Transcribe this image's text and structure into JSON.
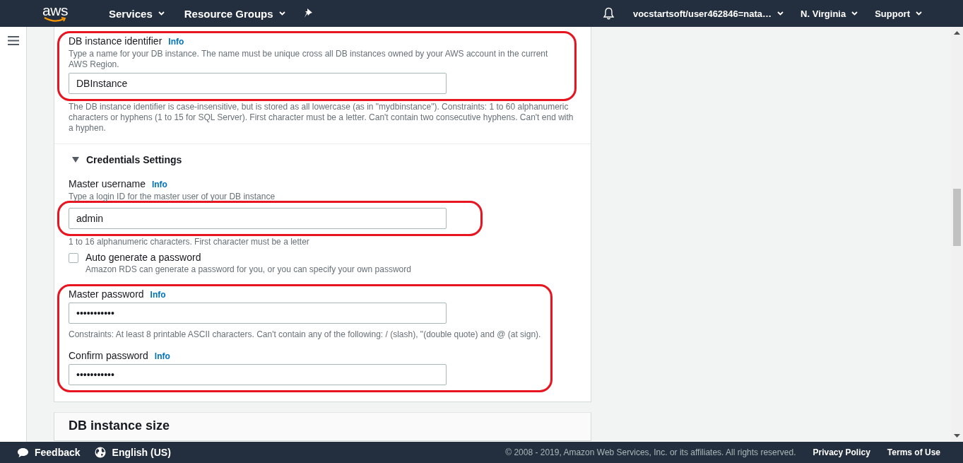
{
  "header": {
    "logo_text": "aws",
    "nav": [
      {
        "label": "Services",
        "dropdown": true
      },
      {
        "label": "Resource Groups",
        "dropdown": true
      }
    ],
    "account": "vocstartsoft/user462846=nata…",
    "region": "N. Virginia",
    "support": "Support"
  },
  "form_blocks": [
    {
      "highlighted": true,
      "items": [
        {
          "kind": "label",
          "text": "DB instance identifier",
          "info": "Info"
        },
        {
          "kind": "description",
          "text": "Type a name for your DB instance. The name must be unique cross all DB instances owned by your AWS account in the current AWS Region."
        },
        {
          "kind": "input",
          "value": "DBInstance"
        }
      ]
    },
    {
      "highlighted": false,
      "items": [
        {
          "kind": "hint",
          "text": "The DB instance identifier is case-insensitive, but is stored as all lowercase (as in \"mydbinstance\"). Constraints: 1 to 60 alphanumeric characters or hyphens (1 to 15 for SQL Server). First character must be a letter. Can't contain two consecutive hyphens. Can't end with a hyphen."
        },
        {
          "kind": "divider"
        },
        {
          "kind": "section",
          "text": "Credentials Settings",
          "expanded": true
        },
        {
          "kind": "label",
          "text": "Master username",
          "info": "Info"
        },
        {
          "kind": "description",
          "text": "Type a login ID for the master user of your DB instance"
        }
      ]
    },
    {
      "highlighted": true,
      "items": [
        {
          "kind": "input",
          "value": "admin"
        }
      ]
    },
    {
      "highlighted": false,
      "items": [
        {
          "kind": "hint",
          "text": "1 to 16 alphanumeric characters. First character must be a letter"
        },
        {
          "kind": "checkbox",
          "text": "Auto generate a password",
          "checked": false,
          "description": "Amazon RDS can generate a password for you, or you can specify your own password"
        }
      ]
    },
    {
      "highlighted": true,
      "items": [
        {
          "kind": "label",
          "text": "Master password",
          "info": "Info"
        },
        {
          "kind": "input",
          "value": "•••••••••••"
        },
        {
          "kind": "hint",
          "text": "Constraints: At least 8 printable ASCII characters. Can't contain any of the following: / (slash), \"(double quote) and @ (at sign)."
        },
        {
          "kind": "label",
          "text": "Confirm password",
          "info": "Info"
        },
        {
          "kind": "input",
          "value": "•••••••••••"
        }
      ]
    }
  ],
  "next_section": {
    "title": "DB instance size"
  },
  "footer": {
    "feedback": "Feedback",
    "language": "English (US)",
    "copyright": "© 2008 - 2019, Amazon Web Services, Inc. or its affiliates. All rights reserved.",
    "links": [
      "Privacy Policy",
      "Terms of Use"
    ]
  }
}
